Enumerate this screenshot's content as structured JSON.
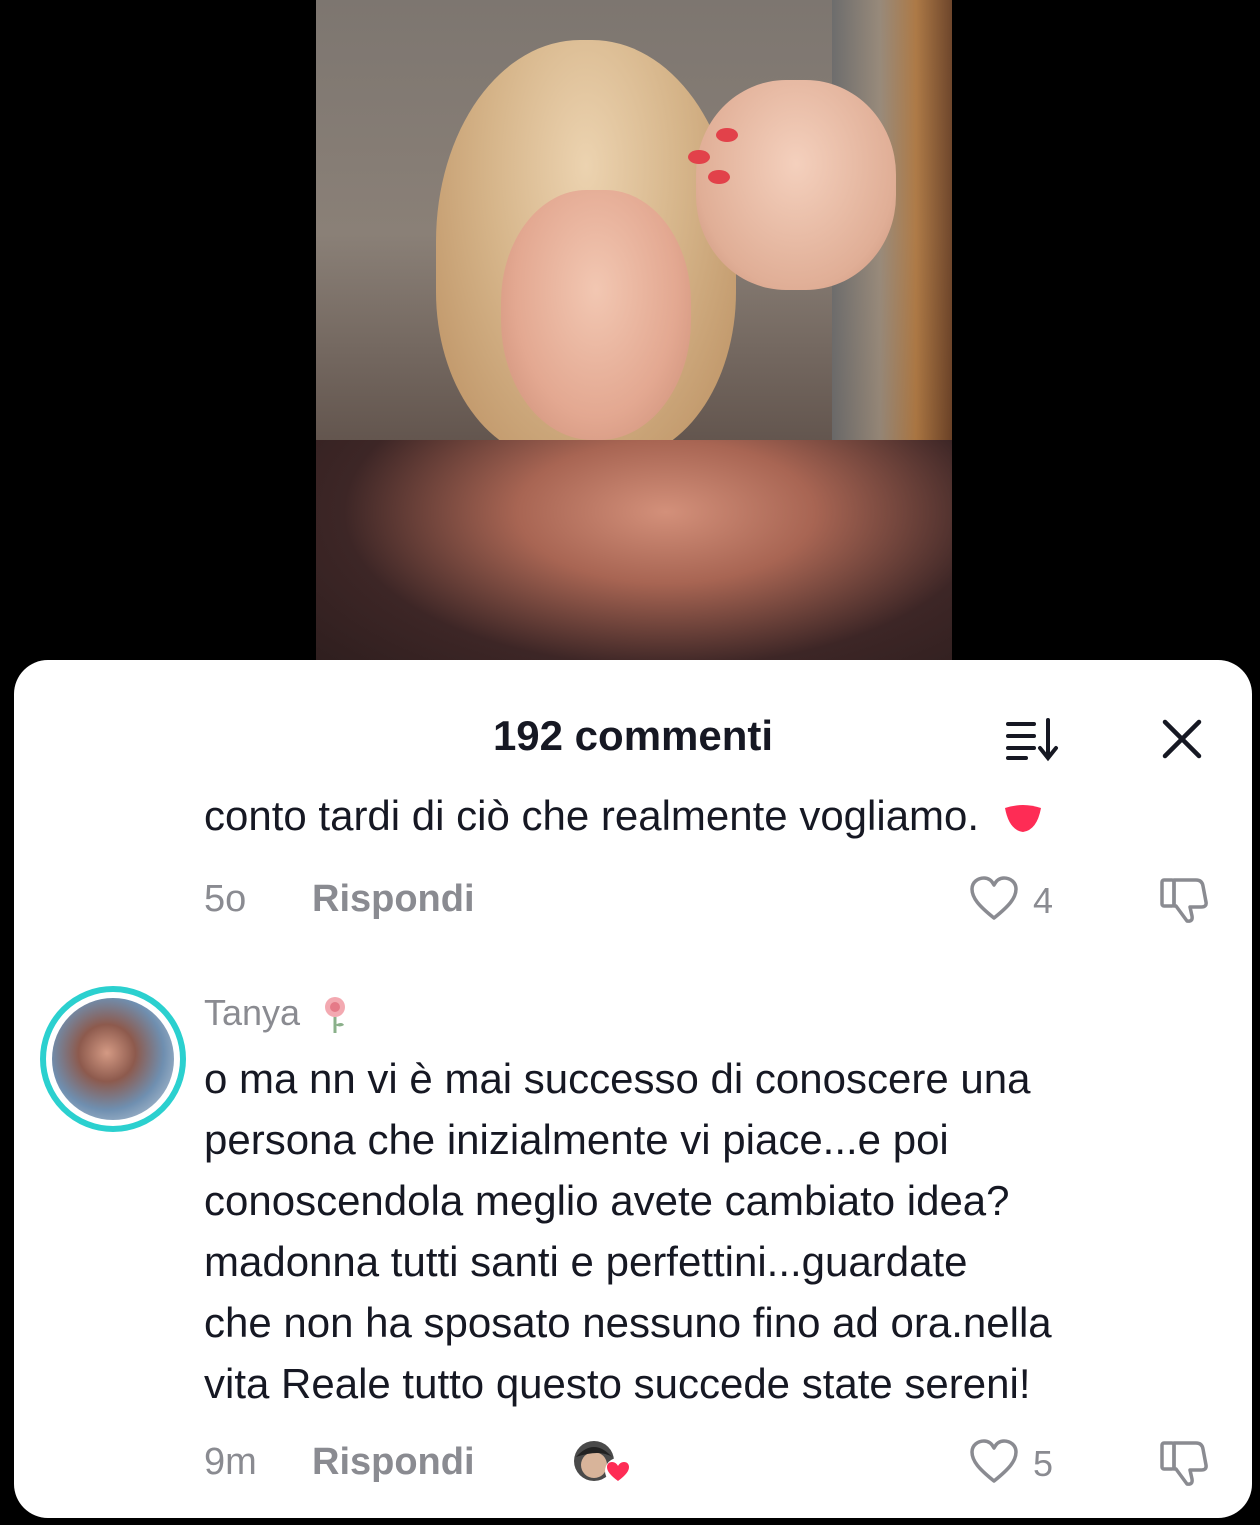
{
  "sheet": {
    "title": "192 commenti",
    "sort_icon": "sort-icon",
    "close_icon": "close-icon"
  },
  "previous_comment": {
    "text_tail": "conto tardi di ciò che realmente vogliamo.",
    "emoji": "heart-emoji",
    "time": "5o",
    "reply_label": "Rispondi",
    "likes": "4"
  },
  "comment": {
    "username": "Tanya",
    "user_badge": "rose-icon",
    "lines": [
      "o ma nn vi è mai successo di conoscere una",
      "persona che inizialmente vi piace...e poi",
      "conoscendola meglio avete cambiato idea?",
      "madonna tutti santi e perfettini...guardate",
      "che non ha sposato nessuno fino ad ora.nella",
      "vita Reale tutto questo succede state sereni!"
    ],
    "time": "9m",
    "reply_label": "Rispondi",
    "likes": "5"
  },
  "colors": {
    "ring": "#2bd0cf",
    "heart_emoji": "#fe2c55",
    "text": "#161823",
    "muted": "#8a8b91"
  }
}
